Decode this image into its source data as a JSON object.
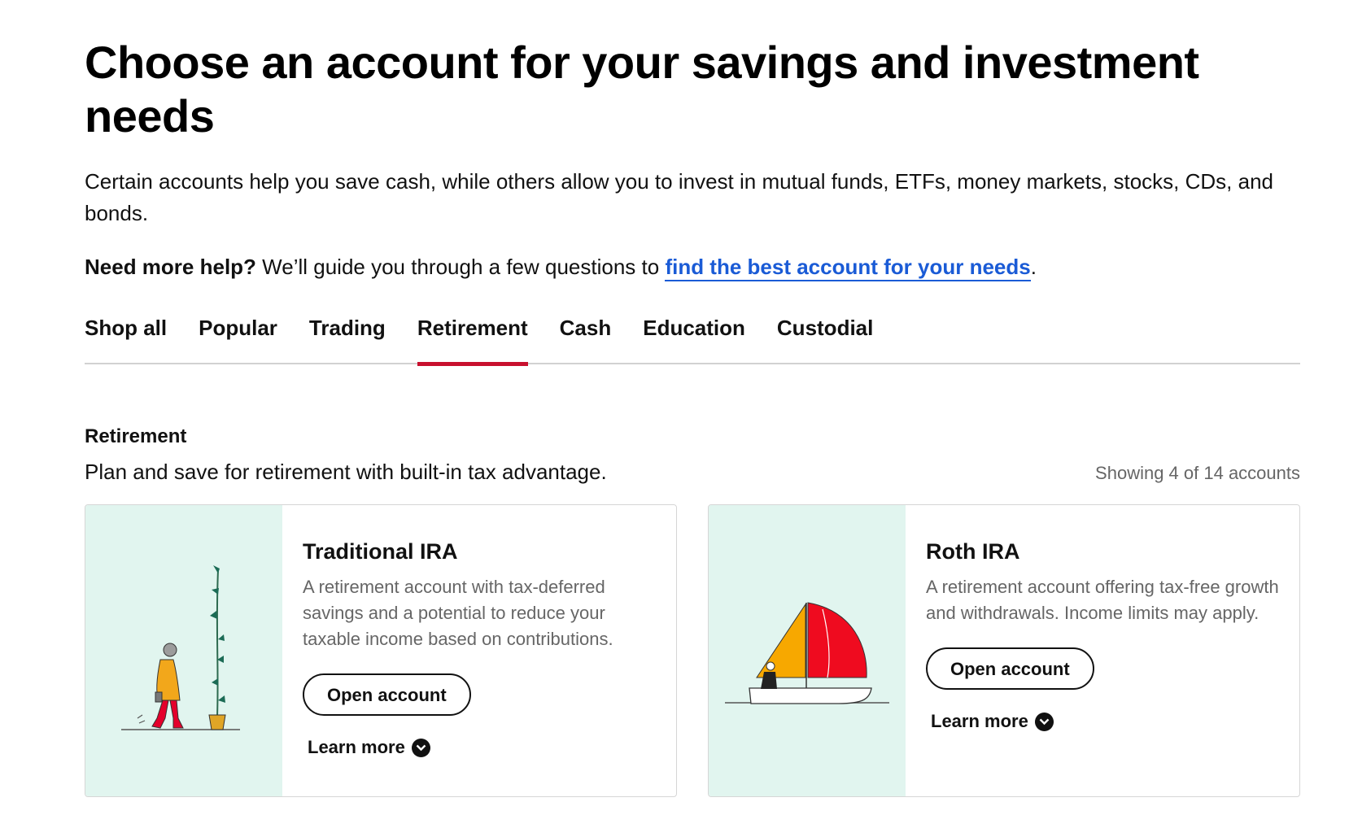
{
  "header": {
    "title": "Choose an account for your savings and investment needs",
    "intro": "Certain accounts help you save cash, while others allow you to invest in mutual funds, ETFs, money markets, stocks, CDs, and bonds.",
    "help_bold": "Need more help?",
    "help_text": " We’ll guide you through a few questions to ",
    "help_link": "find the best account for your needs",
    "help_end": "."
  },
  "tabs": [
    {
      "label": "Shop all",
      "active": false
    },
    {
      "label": "Popular",
      "active": false
    },
    {
      "label": "Trading",
      "active": false
    },
    {
      "label": "Retirement",
      "active": true
    },
    {
      "label": "Cash",
      "active": false
    },
    {
      "label": "Education",
      "active": false
    },
    {
      "label": "Custodial",
      "active": false
    }
  ],
  "section": {
    "title": "Retirement",
    "description": "Plan and save for retirement with built-in tax advantage.",
    "count": "Showing 4 of 14 accounts"
  },
  "cards": [
    {
      "title": "Traditional IRA",
      "description": "A retirement account with tax-deferred savings and a potential to reduce your taxable income based on contributions.",
      "open_label": "Open account",
      "learn_label": "Learn more",
      "illustration": "person-walking-with-plant-icon"
    },
    {
      "title": "Roth IRA",
      "description": "A retirement account offering tax-free growth and withdrawals. Income limits may apply.",
      "open_label": "Open account",
      "learn_label": "Learn more",
      "illustration": "sailboat-icon"
    }
  ],
  "colors": {
    "accent_red": "#c8102e",
    "link_blue": "#1a5bd6",
    "illustration_bg": "#e1f5ef"
  }
}
